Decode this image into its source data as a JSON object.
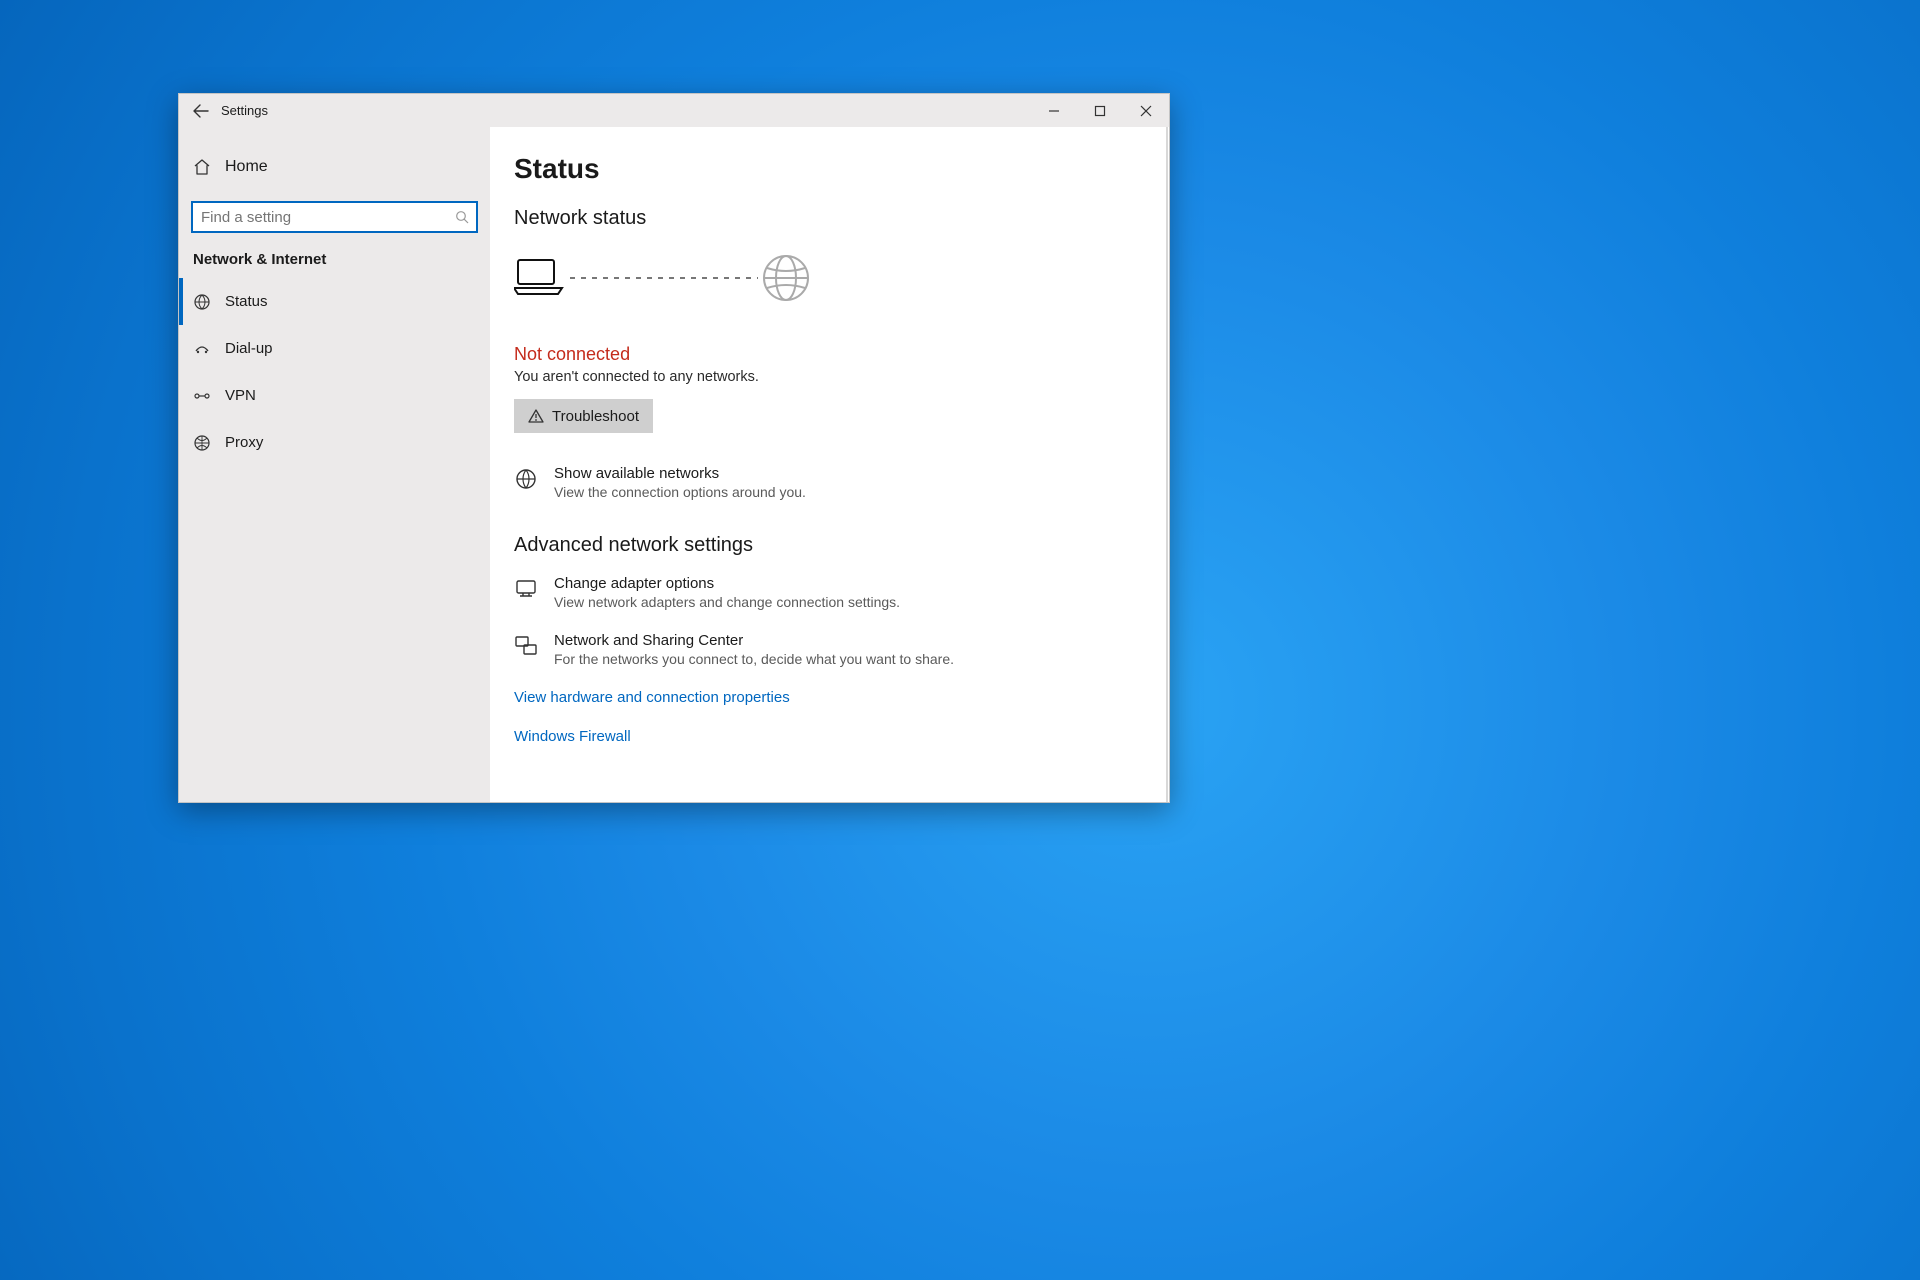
{
  "window": {
    "title": "Settings"
  },
  "sidebar": {
    "home": "Home",
    "search_placeholder": "Find a setting",
    "category": "Network & Internet",
    "items": [
      {
        "label": "Status",
        "selected": true
      },
      {
        "label": "Dial-up",
        "selected": false
      },
      {
        "label": "VPN",
        "selected": false
      },
      {
        "label": "Proxy",
        "selected": false
      }
    ]
  },
  "content": {
    "page_title": "Status",
    "section_network_status": "Network status",
    "not_connected": "Not connected",
    "not_connected_sub": "You aren't connected to any networks.",
    "troubleshoot_label": "Troubleshoot",
    "show_networks": {
      "title": "Show available networks",
      "sub": "View the connection options around you."
    },
    "advanced_heading": "Advanced network settings",
    "adapter": {
      "title": "Change adapter options",
      "sub": "View network adapters and change connection settings."
    },
    "sharing": {
      "title": "Network and Sharing Center",
      "sub": "For the networks you connect to, decide what you want to share."
    },
    "link_hardware": "View hardware and connection properties",
    "link_firewall": "Windows Firewall"
  },
  "colors": {
    "accent": "#0067c0",
    "error": "#c42b1c"
  }
}
